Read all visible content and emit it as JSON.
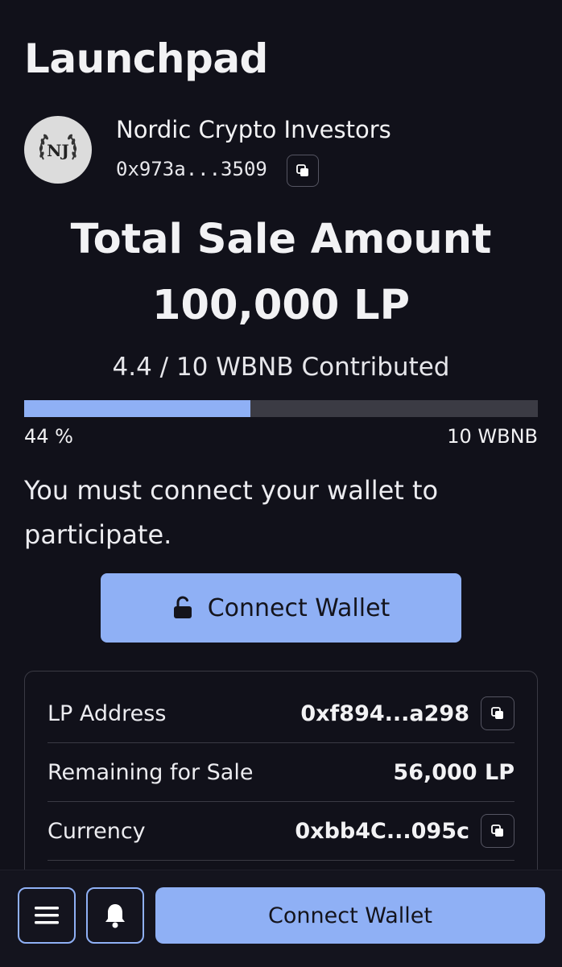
{
  "page": {
    "title": "Launchpad"
  },
  "project": {
    "name": "Nordic Crypto Investors",
    "address": "0x973a...3509",
    "logo_text": "NJ"
  },
  "sale": {
    "title": "Total Sale Amount",
    "amount": "100,000 LP",
    "contributed_text": "4.4 / 10 WBNB Contributed",
    "progress_percent": 44,
    "progress_label": "44 %",
    "progress_max_label": "10 WBNB"
  },
  "connect_message": "You must connect your wallet to participate.",
  "connect_button_label": "Connect Wallet",
  "details": [
    {
      "label": "LP Address",
      "value": "0xf894...a298",
      "copy": true
    },
    {
      "label": "Remaining for Sale",
      "value": "56,000 LP",
      "copy": false
    },
    {
      "label": "Currency",
      "value": "0xbb4C...095c",
      "copy": true
    }
  ],
  "bottom_bar": {
    "connect_label": "Connect Wallet"
  },
  "colors": {
    "accent": "#8fb0f5",
    "background": "#11111a",
    "track": "#3b3b44"
  }
}
